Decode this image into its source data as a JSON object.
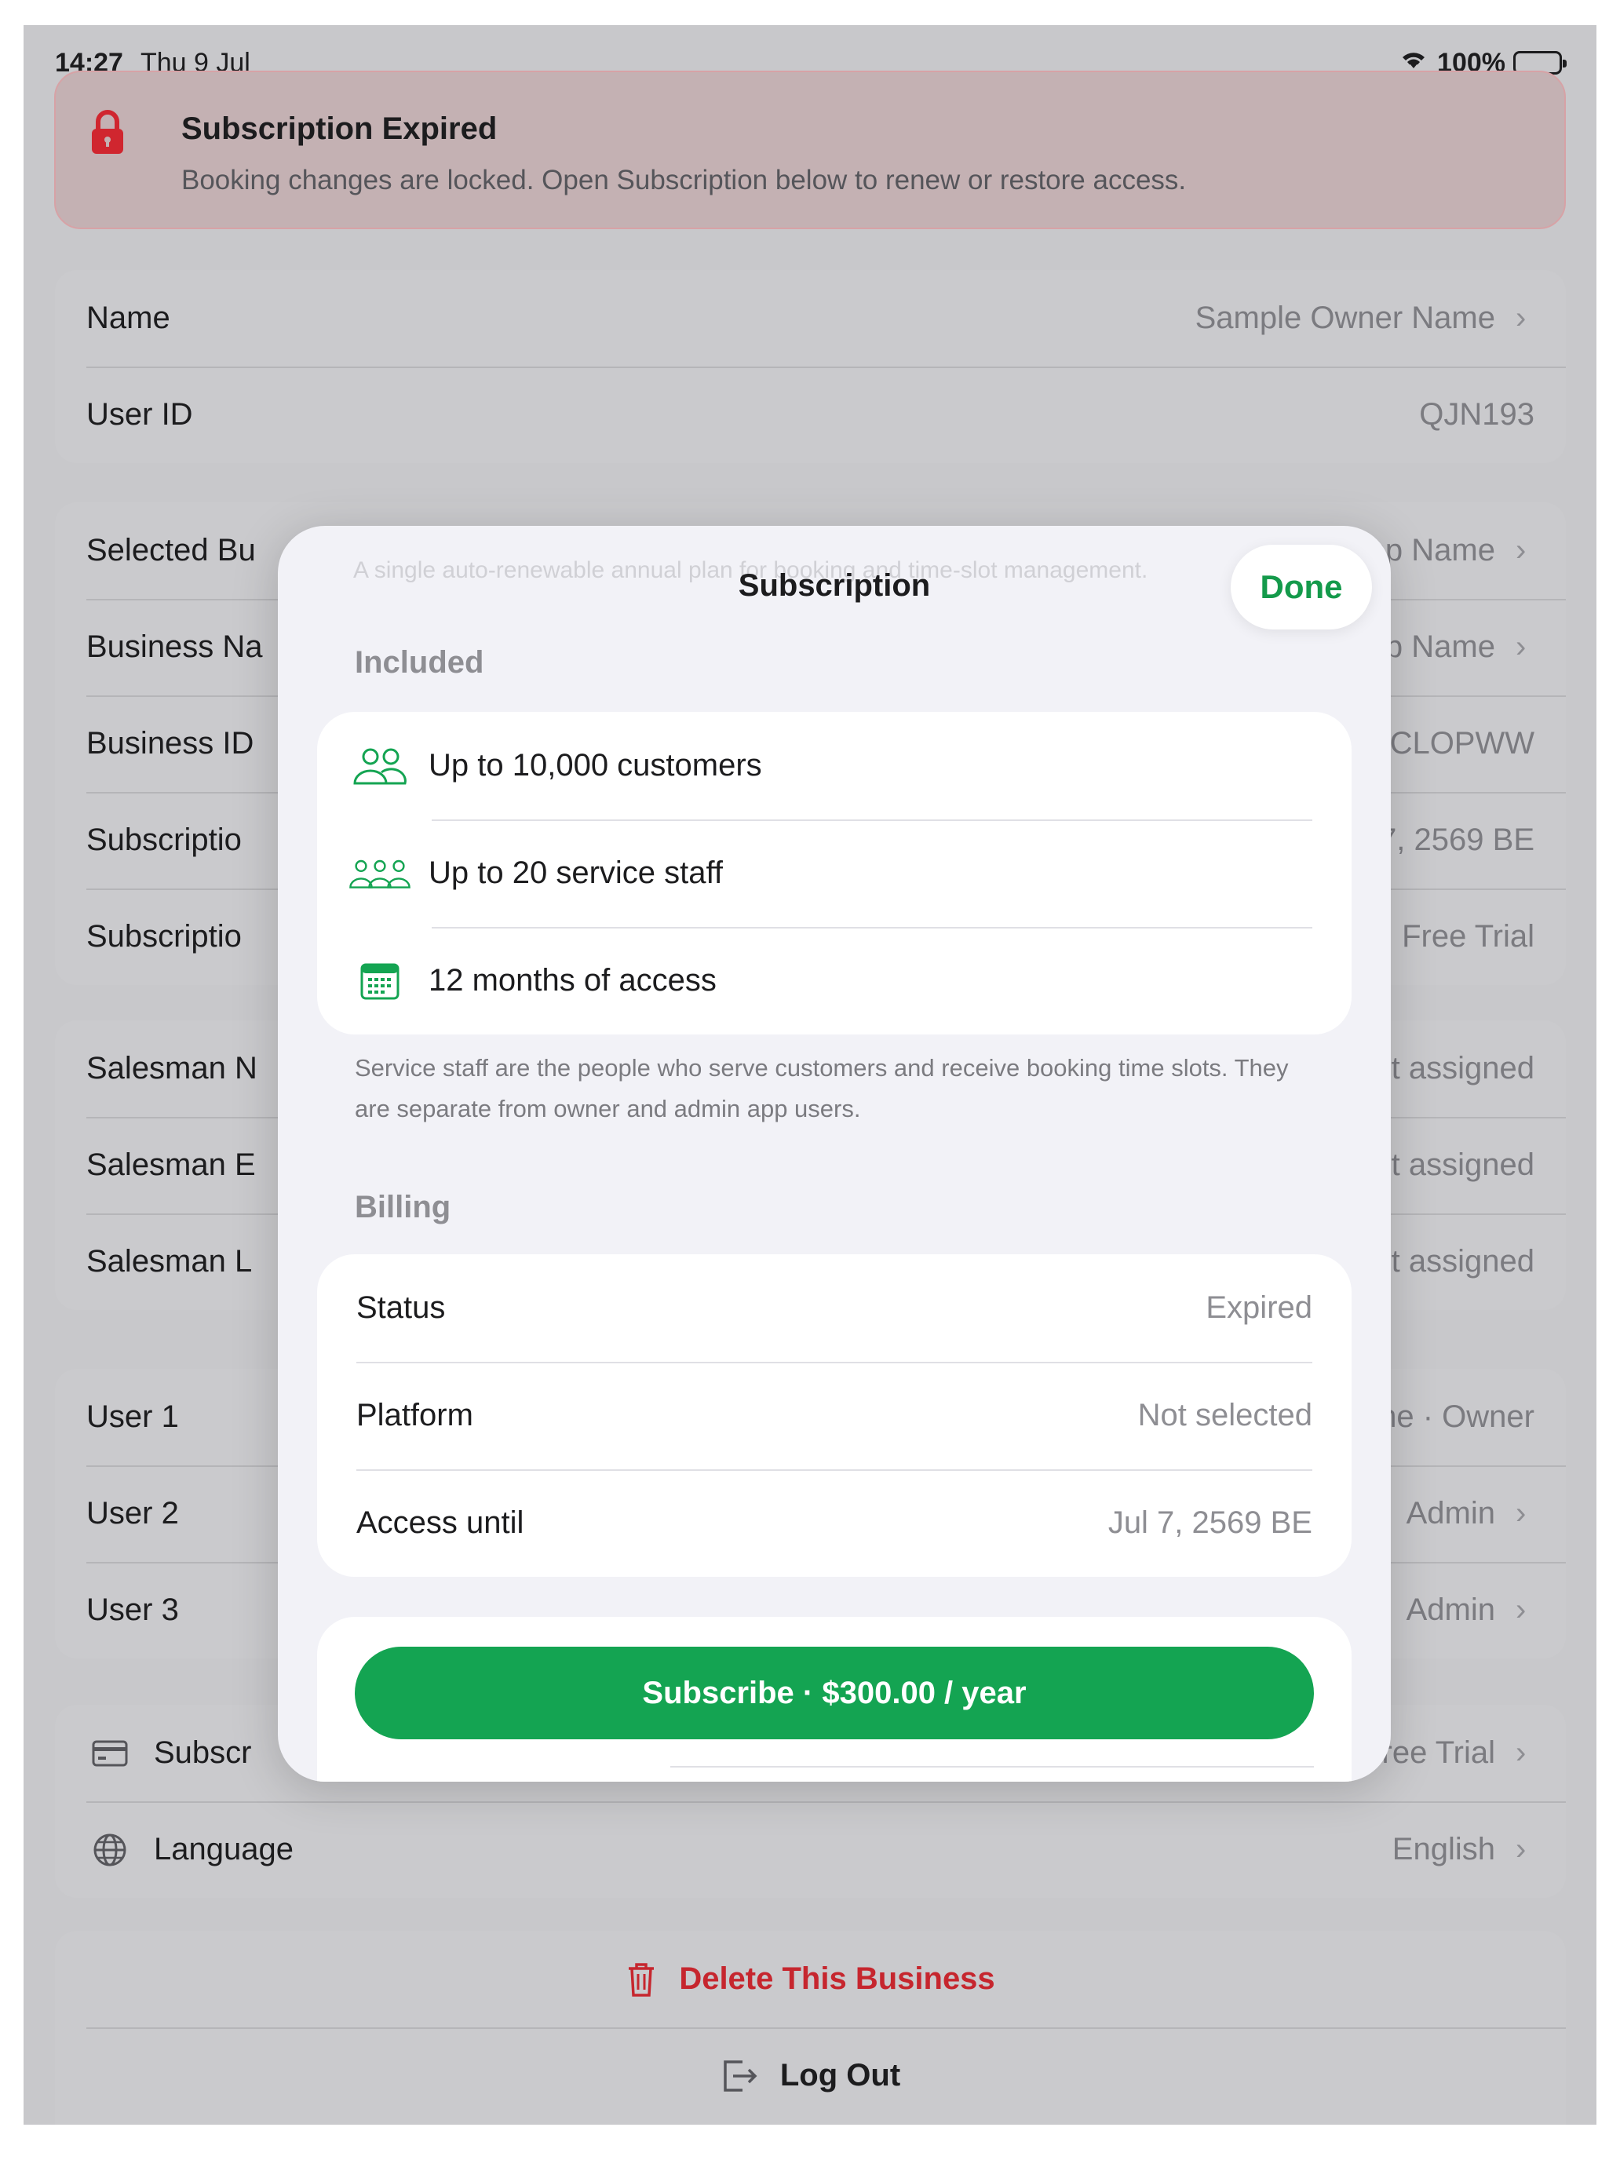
{
  "status_bar": {
    "time": "14:27",
    "date": "Thu 9 Jul",
    "battery": "100%"
  },
  "alert": {
    "title": "Subscription Expired",
    "message": "Booking changes are locked. Open Subscription below to renew or restore access."
  },
  "account": [
    {
      "label": "Name",
      "value": "Sample Owner Name",
      "chevron": true
    },
    {
      "label": "User ID",
      "value": "QJN193",
      "chevron": false
    }
  ],
  "business": [
    {
      "label": "Selected Bu",
      "value": "op Name"
    },
    {
      "label": "Business Na",
      "value": "op Name"
    },
    {
      "label": "Business ID",
      "value": "CLOPWW"
    },
    {
      "label": "Subscriptio",
      "value": "7, 2569 BE"
    },
    {
      "label": "Subscriptio",
      "value": "Free Trial"
    }
  ],
  "salesman": [
    {
      "label": "Salesman N",
      "value": "ot assigned"
    },
    {
      "label": "Salesman E",
      "value": "ot assigned"
    },
    {
      "label": "Salesman L",
      "value": "ot assigned"
    }
  ],
  "users": [
    {
      "label": "User 1",
      "value": "me · Owner"
    },
    {
      "label": "User 2",
      "value": "Admin"
    },
    {
      "label": "User 3",
      "value": "Admin"
    }
  ],
  "settings": [
    {
      "label": "Subscr",
      "value": "Free Trial",
      "icon": "card-icon"
    },
    {
      "label": "Language",
      "value": "English",
      "icon": "globe-icon"
    }
  ],
  "actions": {
    "delete": "Delete This Business",
    "logout": "Log Out"
  },
  "sheet": {
    "ghost_text": "A single auto-renewable annual plan for booking and time-slot management.",
    "title": "Subscription",
    "done": "Done",
    "included_heading": "Included",
    "features": [
      {
        "icon": "people-icon",
        "text": "Up to 10,000 customers"
      },
      {
        "icon": "staff-group-icon",
        "text": "Up to 20 service staff"
      },
      {
        "icon": "calendar-icon",
        "text": "12 months of access"
      }
    ],
    "footnote": "Service staff are the people who serve customers and receive booking time slots. They are separate from owner and admin app users.",
    "billing_heading": "Billing",
    "billing": [
      {
        "label": "Status",
        "value": "Expired"
      },
      {
        "label": "Platform",
        "value": "Not selected"
      },
      {
        "label": "Access until",
        "value": "Jul 7, 2569 BE"
      }
    ],
    "subscribe_label": "Subscribe · $300.00 / year"
  },
  "colors": {
    "accent": "#14a452",
    "danger": "#c6262e",
    "alert_bg": "#c4b1b3"
  }
}
